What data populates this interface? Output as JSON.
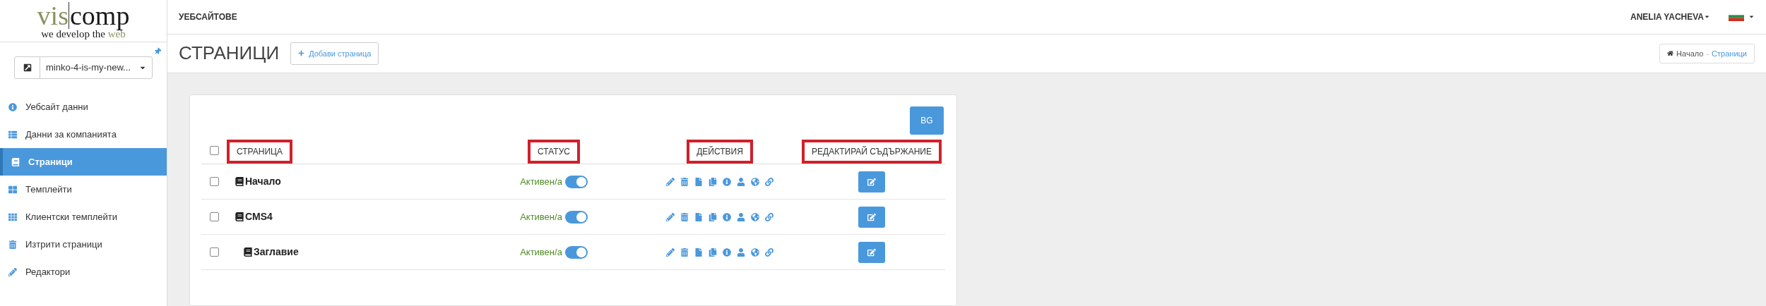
{
  "logo": {
    "name_parts": [
      {
        "text": "vis",
        "color": "#8b9160"
      },
      {
        "text": "comp",
        "color": "#1a1a1a"
      }
    ],
    "tagline_parts": [
      {
        "text": "we develop the ",
        "color": "#1a1a1a"
      },
      {
        "text": "web",
        "color": "#8b9160"
      }
    ]
  },
  "top_bar": {
    "section": "УЕБСАЙТОВЕ",
    "user": "ANELIA YACHEVA"
  },
  "site_selector": {
    "value": "minko-4-is-my-new..."
  },
  "sidebar": {
    "items": [
      {
        "label": "Уебсайт данни",
        "selected": false
      },
      {
        "label": "Данни за компанията",
        "selected": false
      },
      {
        "label": "Страници",
        "selected": true
      },
      {
        "label": "Темплейти",
        "selected": false
      },
      {
        "label": "Клиентски темплейти",
        "selected": false
      },
      {
        "label": "Изтрити страници",
        "selected": false
      },
      {
        "label": "Редактори",
        "selected": false
      }
    ]
  },
  "page_header": {
    "title": "СТРАНИЦИ",
    "add_button": "Добави страница",
    "breadcrumb": [
      "Начало",
      "Страници"
    ],
    "breadcrumb_separator": "-"
  },
  "language_button": "BG",
  "table": {
    "select_all": {
      "checked": false
    },
    "columns": [
      {
        "label": "СТРАНИЦА",
        "highlighted": true
      },
      {
        "label": "СТАТУС",
        "highlighted": true
      },
      {
        "label": "ДЕЙСТВИЯ",
        "highlighted": true
      },
      {
        "label": "РЕДАКТИРАЙ СЪДЪРЖАНИЕ",
        "highlighted": true
      }
    ],
    "rows": [
      {
        "name": "Начало",
        "checked": false,
        "status": "Активен/а",
        "on": true
      },
      {
        "name": "CMS4",
        "checked": false,
        "status": "Активен/а",
        "on": true,
        "children": [
          {
            "name": "Заглавие",
            "checked": false,
            "status": "Активен/а",
            "on": true
          }
        ]
      }
    ]
  }
}
